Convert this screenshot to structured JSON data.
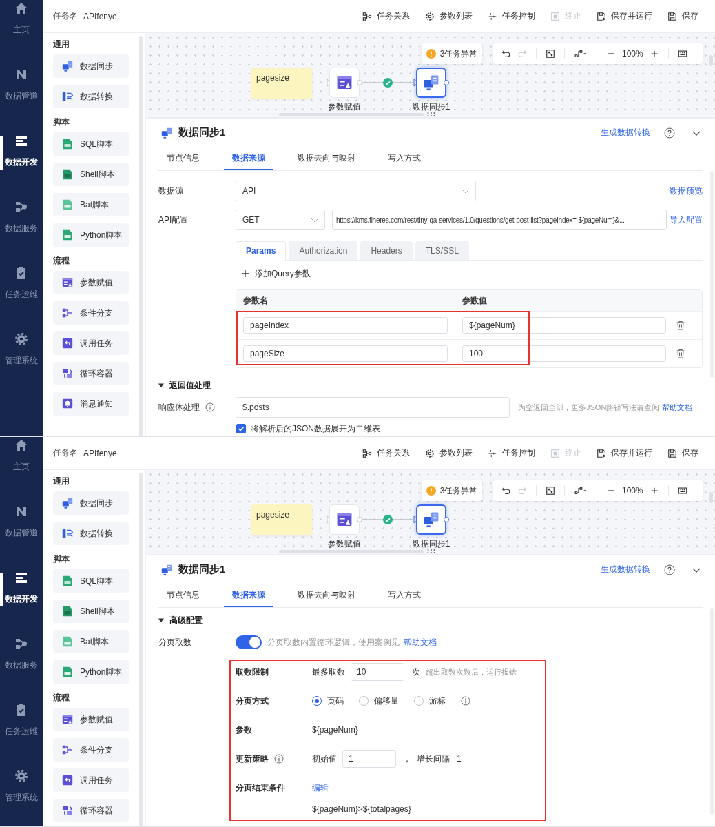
{
  "panes": [
    {
      "nav": [
        {
          "label": "主页",
          "selected": false
        },
        {
          "label": "数据管道",
          "selected": false
        },
        {
          "label": "数据开发",
          "selected": true
        },
        {
          "label": "数据服务",
          "selected": false
        },
        {
          "label": "任务运维",
          "selected": false
        },
        {
          "label": "管理系统",
          "selected": false
        }
      ],
      "task_label": "任务名",
      "task_name": "APIfenye",
      "toolbar": [
        {
          "label": "任务关系",
          "disabled": false
        },
        {
          "label": "参数列表",
          "disabled": false
        },
        {
          "label": "任务控制",
          "disabled": false
        },
        {
          "label": "终止",
          "disabled": true
        },
        {
          "label": "保存并运行",
          "disabled": false
        },
        {
          "label": "保存",
          "disabled": false
        }
      ],
      "palette": [
        {
          "title": "通用",
          "items": [
            "数据同步",
            "数据转换"
          ]
        },
        {
          "title": "脚本",
          "items": [
            "SQL脚本",
            "Shell脚本",
            "Bat脚本",
            "Python脚本"
          ]
        },
        {
          "title": "流程",
          "items": [
            "参数赋值",
            "条件分支",
            "调用任务",
            "循环容器",
            "消息通知"
          ]
        }
      ],
      "canvas": {
        "note": "pagesize",
        "nodes": [
          {
            "label": "参数赋值",
            "selected": false
          },
          {
            "label": "数据同步1",
            "selected": true
          }
        ],
        "alert": "3任务异常",
        "zoom": "100%"
      },
      "panel": {
        "title": "数据同步1",
        "convert_link": "生成数据转换",
        "tabs": [
          {
            "label": "节点信息",
            "selected": false
          },
          {
            "label": "数据来源",
            "selected": true
          },
          {
            "label": "数据去向与映射",
            "selected": false
          },
          {
            "label": "写入方式",
            "selected": false
          }
        ],
        "content": {
          "kind": "api_source",
          "source_label": "数据源",
          "source_value": "API",
          "preview_link": "数据预览",
          "api_label": "API配置",
          "method": "GET",
          "url": "https://kms.fineres.com/rest/tiny-qa-services/1.0/questions/get-post-list?pageIndex= ${pageNum}&...",
          "import_link": "导入配置",
          "subtabs": [
            {
              "label": "Params",
              "selected": true
            },
            {
              "label": "Authorization",
              "selected": false
            },
            {
              "label": "Headers",
              "selected": false
            },
            {
              "label": "TLS/SSL",
              "selected": false
            }
          ],
          "add_param": "添加Query参数",
          "table": {
            "columns": [
              "参数名",
              "参数值"
            ],
            "highlighted": true,
            "rows": [
              {
                "name": "pageIndex",
                "value": "${pageNum}"
              },
              {
                "name": "pageSize",
                "value": "100"
              }
            ]
          },
          "section": {
            "title": "返回值处理",
            "expanded": true
          },
          "response_label": "响应体处理",
          "response_value": "$.posts",
          "response_hint": "为空返回全部，更多JSON路径写法请查阅",
          "help_link": "帮助文档",
          "flatten": {
            "label": "将解析后的JSON数据展开为二维表",
            "checked": true
          }
        }
      }
    },
    {
      "nav": [
        {
          "label": "主页",
          "selected": false
        },
        {
          "label": "数据管道",
          "selected": false
        },
        {
          "label": "数据开发",
          "selected": true
        },
        {
          "label": "数据服务",
          "selected": false
        },
        {
          "label": "任务运维",
          "selected": false
        },
        {
          "label": "管理系统",
          "selected": false
        }
      ],
      "task_label": "任务名",
      "task_name": "APIfenye",
      "toolbar": [
        {
          "label": "任务关系",
          "disabled": false
        },
        {
          "label": "参数列表",
          "disabled": false
        },
        {
          "label": "任务控制",
          "disabled": false
        },
        {
          "label": "终止",
          "disabled": true
        },
        {
          "label": "保存并运行",
          "disabled": false
        },
        {
          "label": "保存",
          "disabled": false
        }
      ],
      "palette": [
        {
          "title": "通用",
          "items": [
            "数据同步",
            "数据转换"
          ]
        },
        {
          "title": "脚本",
          "items": [
            "SQL脚本",
            "Shell脚本",
            "Bat脚本",
            "Python脚本"
          ]
        },
        {
          "title": "流程",
          "items": [
            "参数赋值",
            "条件分支",
            "调用任务",
            "循环容器"
          ]
        }
      ],
      "canvas": {
        "note": "pagesize",
        "nodes": [
          {
            "label": "参数赋值",
            "selected": false
          },
          {
            "label": "数据同步1",
            "selected": true
          }
        ],
        "alert": "3任务异常",
        "zoom": "100%"
      },
      "panel": {
        "title": "数据同步1",
        "convert_link": "生成数据转换",
        "tabs": [
          {
            "label": "节点信息",
            "selected": false
          },
          {
            "label": "数据来源",
            "selected": true
          },
          {
            "label": "数据去向与映射",
            "selected": false
          },
          {
            "label": "写入方式",
            "selected": false
          }
        ],
        "content": {
          "kind": "pagination",
          "section": {
            "title": "高级配置",
            "expanded": true
          },
          "paging": {
            "label": "分页取数",
            "on": true,
            "hint": "分页取数内置循环逻辑，使用案例见",
            "help_link": "帮助文档"
          },
          "highlighted": true,
          "limit": {
            "label": "取数限制",
            "prefix": "最多取数",
            "value": "10",
            "unit": "次",
            "hint": "超出取数次数后，运行报错"
          },
          "mode": {
            "label": "分页方式",
            "options": [
              {
                "label": "页码",
                "selected": true
              },
              {
                "label": "偏移量",
                "selected": false
              },
              {
                "label": "游标",
                "selected": false
              }
            ]
          },
          "param": {
            "label": "参数",
            "value": "${pageNum}"
          },
          "update": {
            "label": "更新策略",
            "initial_label": "初始值",
            "initial_value": "1",
            "separator": "，",
            "step_label": "增长间隔",
            "step_value": "1"
          },
          "end": {
            "label": "分页结束条件",
            "edit_link": "编辑",
            "expression": "${pageNum}>${totalpages}"
          }
        }
      }
    }
  ]
}
